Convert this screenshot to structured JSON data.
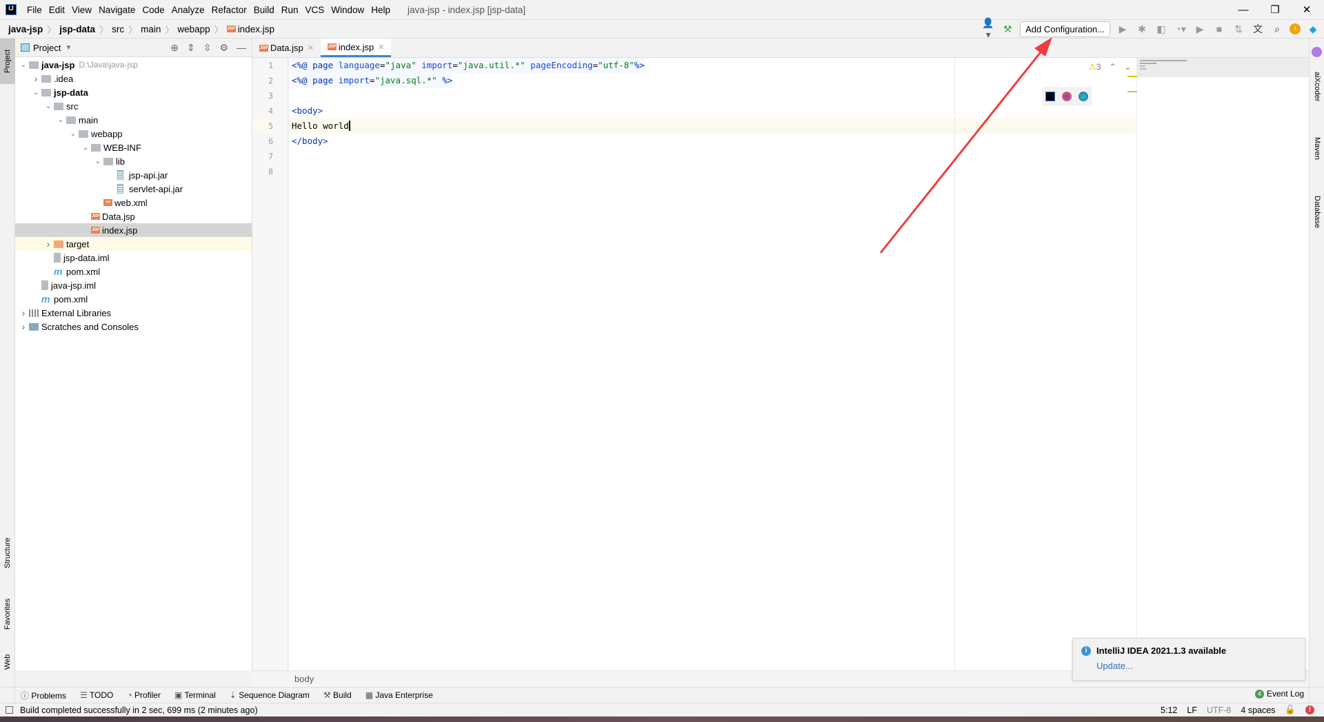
{
  "window": {
    "title": "java-jsp - index.jsp [jsp-data]",
    "logo": "IJ"
  },
  "menu": [
    "File",
    "Edit",
    "View",
    "Navigate",
    "Code",
    "Analyze",
    "Refactor",
    "Build",
    "Run",
    "VCS",
    "Window",
    "Help"
  ],
  "breadcrumb": [
    "java-jsp",
    "jsp-data",
    "src",
    "main",
    "webapp",
    "index.jsp"
  ],
  "toolbar": {
    "add_config": "Add Configuration..."
  },
  "project": {
    "title": "Project",
    "tree": [
      {
        "label": "java-jsp",
        "path": "D:\\Java\\java-jsp",
        "depth": 0,
        "arrow": "down",
        "icon": "module",
        "bold": true
      },
      {
        "label": ".idea",
        "depth": 1,
        "arrow": "right",
        "icon": "folder"
      },
      {
        "label": "jsp-data",
        "depth": 1,
        "arrow": "down",
        "icon": "module",
        "bold": true
      },
      {
        "label": "src",
        "depth": 2,
        "arrow": "down",
        "icon": "folder"
      },
      {
        "label": "main",
        "depth": 3,
        "arrow": "down",
        "icon": "folder"
      },
      {
        "label": "webapp",
        "depth": 4,
        "arrow": "down",
        "icon": "folder"
      },
      {
        "label": "WEB-INF",
        "depth": 5,
        "arrow": "down",
        "icon": "folder"
      },
      {
        "label": "lib",
        "depth": 6,
        "arrow": "down",
        "icon": "folder"
      },
      {
        "label": "jsp-api.jar",
        "depth": 7,
        "icon": "jar"
      },
      {
        "label": "servlet-api.jar",
        "depth": 7,
        "icon": "jar"
      },
      {
        "label": "web.xml",
        "depth": 6,
        "icon": "xml"
      },
      {
        "label": "Data.jsp",
        "depth": 5,
        "icon": "jsp"
      },
      {
        "label": "index.jsp",
        "depth": 5,
        "icon": "jsp",
        "selected": true
      },
      {
        "label": "target",
        "depth": 2,
        "arrow": "right",
        "icon": "folder-orange",
        "highlight": true
      },
      {
        "label": "jsp-data.iml",
        "depth": 2,
        "icon": "iml"
      },
      {
        "label": "pom.xml",
        "depth": 2,
        "icon": "maven"
      },
      {
        "label": "java-jsp.iml",
        "depth": 1,
        "icon": "iml"
      },
      {
        "label": "pom.xml",
        "depth": 1,
        "icon": "maven"
      },
      {
        "label": "External Libraries",
        "depth": 0,
        "arrow": "right",
        "icon": "libs"
      },
      {
        "label": "Scratches and Consoles",
        "depth": 0,
        "arrow": "right",
        "icon": "scratch"
      }
    ]
  },
  "tabs": [
    {
      "label": "Data.jsp",
      "active": false
    },
    {
      "label": "index.jsp",
      "active": true
    }
  ],
  "editor": {
    "line_numbers": [
      "1",
      "2",
      "3",
      "4",
      "5",
      "6",
      "7",
      "8"
    ],
    "warnings": "3",
    "caret": "5:12"
  },
  "left_stripe": [
    "Project",
    "Structure",
    "Favorites",
    "Web"
  ],
  "right_stripe": [
    "aiXcoder",
    "Maven",
    "Database"
  ],
  "code_breadcrumb": "body",
  "tool_windows": [
    "Problems",
    "TODO",
    "Profiler",
    "Terminal",
    "Sequence Diagram",
    "Build",
    "Java Enterprise"
  ],
  "event_log": {
    "label": "Event Log",
    "count": "4"
  },
  "status": {
    "message": "Build completed successfully in 2 sec, 699 ms (2 minutes ago)",
    "position": "5:12",
    "line_sep": "LF",
    "encoding": "UTF-8",
    "indent": "4 spaces"
  },
  "notification": {
    "title": "IntelliJ IDEA 2021.1.3 available",
    "link": "Update..."
  },
  "colors": {
    "accent": "#4083c9",
    "annotation_arrow": "#f03c3c"
  }
}
